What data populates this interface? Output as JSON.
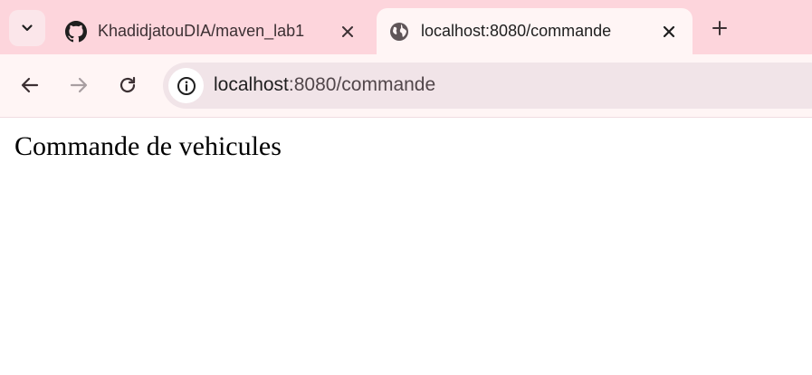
{
  "browser": {
    "tabs": [
      {
        "title": "KhadidjatouDIA/maven_lab1",
        "favicon": "github-icon",
        "active": false
      },
      {
        "title": "localhost:8080/commande",
        "favicon": "globe-icon",
        "active": true
      }
    ],
    "omnibox": {
      "host": "localhost",
      "rest": ":8080/commande"
    }
  },
  "page": {
    "heading": "Commande de vehicules"
  },
  "colors": {
    "tabstrip_bg": "#fdd5dc",
    "active_tab_bg": "#fff5f5",
    "omnibox_bg": "#f1e4e8"
  }
}
